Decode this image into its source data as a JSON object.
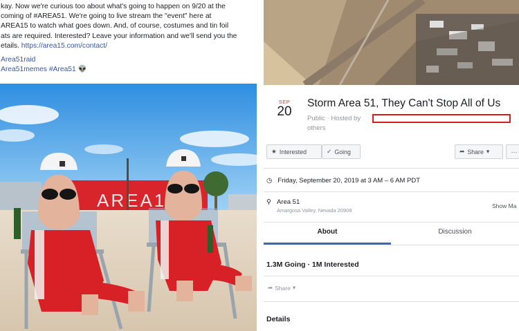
{
  "post": {
    "line1": "kay. Now we're curious too about what's going to happen on 9/20 at the",
    "line2": "coming of #AREA51. We're going to live stream the \"event\" here at",
    "line3": "AREA15 to watch what goes down. And, of course, costumes and tin foil",
    "line4": "ats are required. Interested? Leave your information and we'll send you the",
    "line5_prefix": "etails.",
    "link": "https://area15.com/contact/",
    "tag1": "Area51raid",
    "tag2": "Area51memes #Area51",
    "tag2_emoji": "👽",
    "photo_sign": "AREA15"
  },
  "event": {
    "month": "SEP",
    "day": "20",
    "title": "Storm Area 51, They Can't Stop All of Us",
    "hosted_by": "Public · Hosted by",
    "others": "others",
    "interested_label": "Interested",
    "going_label": "Going",
    "share_label": "Share",
    "more_label": "···",
    "datetime": "Friday, September 20, 2019 at 3 AM – 6 AM PDT",
    "location_name": "Area 51",
    "location_address": "Amargosa Valley, Nevada 20908",
    "show_map": "Show Ma",
    "tab_about": "About",
    "tab_discussion": "Discussion",
    "stats": "1.3M Going · 1M Interested",
    "share_small": "Share",
    "details": "Details"
  },
  "colors": {
    "accent": "#4267b2",
    "redact_border": "#d81b1b",
    "month": "#e03a2f",
    "link": "#385898"
  },
  "icons": [
    "star-icon",
    "check-icon",
    "share-arrow-icon",
    "chevron-down-icon",
    "clock-icon",
    "location-pin-icon",
    "more-icon"
  ]
}
